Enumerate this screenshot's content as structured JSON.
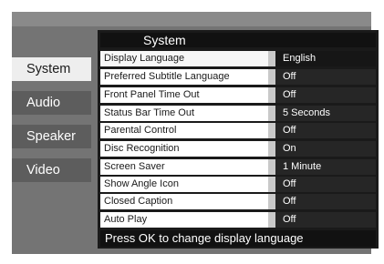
{
  "tabs": [
    {
      "label": "System",
      "active": true
    },
    {
      "label": "Audio",
      "active": false
    },
    {
      "label": "Speaker",
      "active": false
    },
    {
      "label": "Video",
      "active": false
    }
  ],
  "panel": {
    "title": "System",
    "rows": [
      {
        "label": "Display Language",
        "value": "English"
      },
      {
        "label": "Preferred Subtitle Language",
        "value": "Off"
      },
      {
        "label": "Front Panel Time Out",
        "value": "Off"
      },
      {
        "label": "Status Bar Time Out",
        "value": "5 Seconds"
      },
      {
        "label": "Parental Control",
        "value": "Off"
      },
      {
        "label": "Disc Recognition",
        "value": "On"
      },
      {
        "label": "Screen Saver",
        "value": "1 Minute"
      },
      {
        "label": "Show Angle Icon",
        "value": "Off"
      },
      {
        "label": "Closed Caption",
        "value": "Off"
      },
      {
        "label": "Auto Play",
        "value": "Off"
      }
    ]
  },
  "hint": "Press OK to change display language"
}
